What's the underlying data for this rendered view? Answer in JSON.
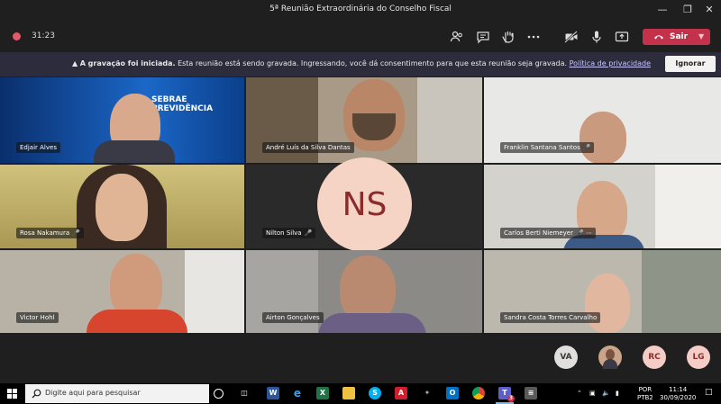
{
  "window": {
    "title": "5ª Reunião Extraordinária do Conselho Fiscal",
    "minimize_icon": "minimize-icon",
    "maximize_icon": "maximize-icon",
    "close_icon": "close-icon"
  },
  "meeting_bar": {
    "timer": "31:23",
    "tools": [
      "participants-icon",
      "chat-icon",
      "raise-hand-icon",
      "more-icon",
      "camera-off-icon",
      "microphone-icon",
      "share-icon"
    ],
    "leave_label": "Sair",
    "leave_color": "#c4314b"
  },
  "banner": {
    "bold_text": "A gravação foi iniciada.",
    "text": "Esta reunião está sendo gravada. Ingressando, você dá consentimento para que esta reunião seja gravada.",
    "link_text": "Política de privacidade",
    "ignore_label": "Ignorar"
  },
  "participants": [
    {
      "name": "Edjair Alves",
      "mic": false
    },
    {
      "name": "André Luís da Silva Dantas",
      "mic": false
    },
    {
      "name": "Franklin Santana Santos",
      "mic": true
    },
    {
      "name": "Rosa Nakamura",
      "mic": true
    },
    {
      "name": "Nilton Silva",
      "mic": true
    },
    {
      "name": "Carlos Berti Niemeyer",
      "mic": true
    },
    {
      "name": "Victor Hohl",
      "mic": false
    },
    {
      "name": "Airton Gonçalves",
      "mic": false
    },
    {
      "name": "Sandra Costa Torres Carvalho",
      "mic": false
    }
  ],
  "center_avatar": {
    "initials": "NS"
  },
  "sebrae_sign": {
    "line1": "SEBRAE",
    "line2": "PREVIDÊNCIA"
  },
  "overflow_avatars": [
    {
      "initials": "VA",
      "color": "#e1dfdd",
      "text_color": "#3b3a39"
    },
    {
      "initials": "",
      "color": "#caa58a"
    },
    {
      "initials": "RC",
      "color": "#f4cdc6",
      "text_color": "#8c2b2b"
    },
    {
      "initials": "LG",
      "color": "#f4cdc6",
      "text_color": "#8c2b2b"
    }
  ],
  "taskbar": {
    "search_placeholder": "Digite aqui para pesquisar",
    "apps": [
      "task-view-icon",
      "word-icon",
      "edge-icon",
      "excel-icon",
      "file-explorer-icon",
      "skype-icon",
      "acrobat-icon",
      "sharepoint-icon",
      "outlook-icon",
      "chrome-icon",
      "teams-icon",
      "calculator-icon"
    ],
    "teams_badge": "3",
    "lang_line1": "POR",
    "lang_line2": "PTB2",
    "time": "11:14",
    "date": "30/09/2020"
  }
}
